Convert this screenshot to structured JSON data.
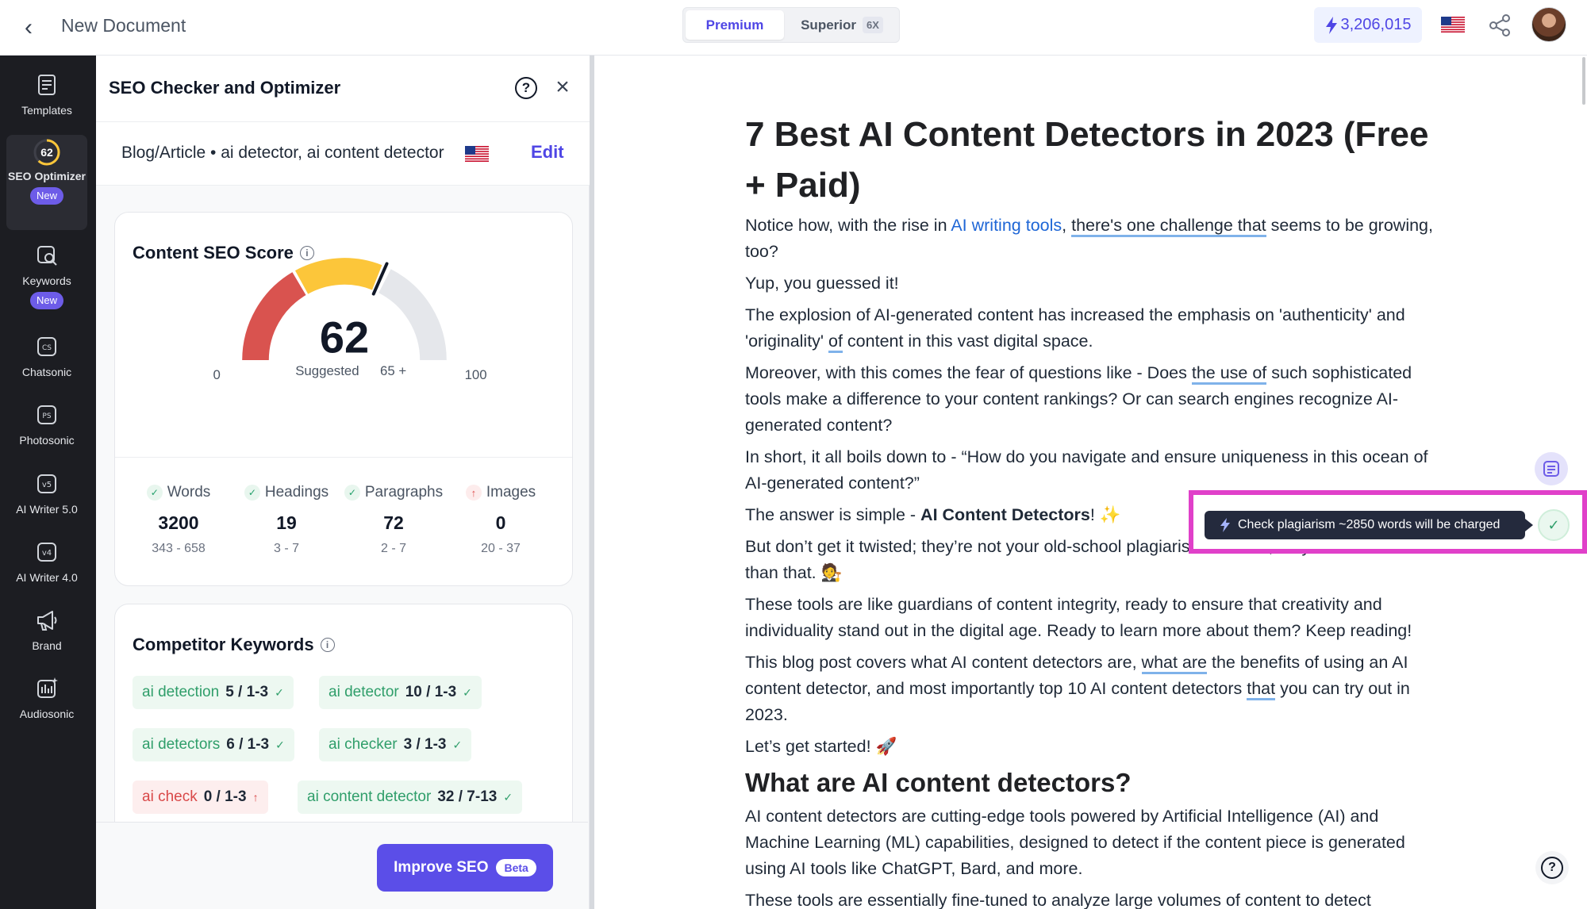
{
  "header": {
    "title": "New Document",
    "tabs": [
      {
        "label": "Premium"
      },
      {
        "label": "Superior",
        "badge": "6X"
      }
    ],
    "credits": "3,206,015"
  },
  "sidebar": {
    "items": [
      {
        "label": "Templates",
        "icon": "templates-icon"
      },
      {
        "label": "SEO Optimizer",
        "score": "62",
        "badge": "New",
        "active": true
      },
      {
        "label": "Keywords",
        "icon": "keywords-icon",
        "badge": "New"
      },
      {
        "label": "Chatsonic",
        "icon": "chatsonic-icon",
        "glyph": "CS"
      },
      {
        "label": "Photosonic",
        "icon": "photosonic-icon",
        "glyph": "PS"
      },
      {
        "label": "AI Writer 5.0",
        "icon": "ai-writer-5-icon",
        "glyph": "v5"
      },
      {
        "label": "AI Writer 4.0",
        "icon": "ai-writer-4-icon",
        "glyph": "v4"
      },
      {
        "label": "Brand",
        "icon": "megaphone-icon"
      },
      {
        "label": "Audiosonic",
        "icon": "audiosonic-icon"
      }
    ]
  },
  "panel": {
    "title": "SEO Checker and Optimizer",
    "subtitle": "Blog/Article • ai detector, ai content detector",
    "edit_label": "Edit",
    "score_card": {
      "title": "Content SEO Score",
      "score": "62",
      "score_value": 62,
      "suggested_label": "Suggested",
      "suggested_value": "65 +",
      "min": "0",
      "max": "100",
      "stats": [
        {
          "label": "Words",
          "value": "3200",
          "range": "343 - 658",
          "status": "ok"
        },
        {
          "label": "Headings",
          "value": "19",
          "range": "3 - 7",
          "status": "ok"
        },
        {
          "label": "Paragraphs",
          "value": "72",
          "range": "2 - 7",
          "status": "ok"
        },
        {
          "label": "Images",
          "value": "0",
          "range": "20 - 37",
          "status": "low"
        }
      ]
    },
    "competitor_keywords": {
      "title": "Competitor Keywords",
      "items": [
        {
          "term": "ai detection",
          "count": "5 / 1-3",
          "status": "ok"
        },
        {
          "term": "ai detector",
          "count": "10 / 1-3",
          "status": "ok"
        },
        {
          "term": "ai detectors",
          "count": "6 / 1-3",
          "status": "ok"
        },
        {
          "term": "ai checker",
          "count": "3 / 1-3",
          "status": "ok"
        },
        {
          "term": "ai check",
          "count": "0 / 1-3",
          "status": "low"
        },
        {
          "term": "ai content detector",
          "count": "32 / 7-13",
          "status": "ok"
        }
      ]
    },
    "improve_button": "Improve SEO",
    "improve_badge": "Beta"
  },
  "editor": {
    "h1": "7 Best AI Content Detectors in 2023 (Free + Paid)",
    "p1_a": "Notice how, with the rise in ",
    "p1_link": "AI writing tools",
    "p1_b": ", ",
    "p1_ul": "there's one challenge that",
    "p1_c": " seems to be growing, too?",
    "p2": "Yup, you guessed it!",
    "p3_a": "The explosion of AI-generated content has increased the emphasis on 'authenticity' and 'originality' ",
    "p3_ul": "of",
    "p3_b": " content in this vast digital space.",
    "p4_a": "Moreover, with this comes the fear of questions like - Does ",
    "p4_ul": "the use of",
    "p4_b": " such sophisticated tools make a difference to your content rankings? Or can search engines recognize AI-generated content?",
    "p5": "In short, it all boils down to - “How do you navigate and ensure uniqueness in this ocean of AI-generated content?”",
    "p6_a": "The answer is simple - ",
    "p6_b": "AI Content Detectors",
    "p6_c": "! ✨",
    "p7": "But don’t get it twisted; they’re not your old-school plagiarism checker; they’re much more than that. 🧑‍⚖️",
    "p8": "These tools are like guardians of content integrity, ready to ensure that creativity and individuality stand out in the digital age. Ready to learn more about them? Keep reading!",
    "p9_a": "This blog post covers what AI content detectors are, ",
    "p9_ul1": "what are",
    "p9_b": " the benefits of using an AI content detector, and most importantly top 10 AI content detectors ",
    "p9_ul2": "that",
    "p9_c": " you can try out in 2023.",
    "p10": "Let’s get started! 🚀",
    "h2": "What are AI content detectors?",
    "p11": "AI content detectors are cutting-edge tools powered by Artificial Intelligence (AI) and Machine Learning (ML) capabilities, designed to detect if the content piece is generated using AI tools like ChatGPT, Bard, and more.",
    "p12": "These tools are essentially fine-tuned to analyze large volumes of content to detect"
  },
  "plagiarism": {
    "label": "Check plagiarism ~2850 words will be charged"
  },
  "colors": {
    "accent": "#5b4ee8",
    "gauge_red": "#d9534f",
    "gauge_yellow": "#fcc63a",
    "gauge_gray": "#e5e7eb",
    "highlight": "#e040c9"
  }
}
